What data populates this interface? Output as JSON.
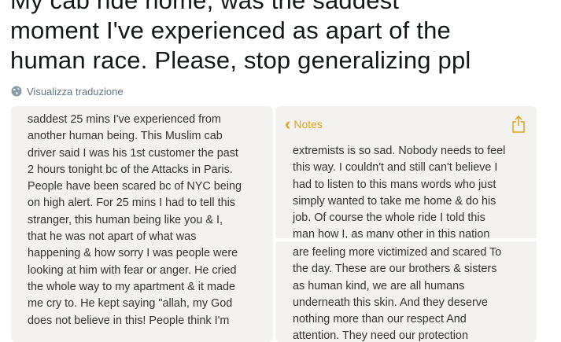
{
  "tweet": {
    "lines": [
      "My cab ride home, was the saddest",
      "moment I've experienced as apart of the",
      "human race. Please, stop generalizing ppl"
    ],
    "translate_label": "Visualizza traduzione",
    "translate_icon": "globe-icon"
  },
  "left_note": {
    "lines": [
      "saddest 25 mins I've experienced from",
      "another human being. This Muslim cab",
      "driver said I was his 1st customer the past",
      "2 hours tonight bc of the Attacks in Paris.",
      "People have been scared bc of NYC being",
      "on high alert. For 25 mins I had to tell this",
      "stranger, this human being like you & I,",
      "that he was not apart of what was",
      "happening & how sorry I was people were",
      "looking at him with fear or anger. He cried",
      "the whole way to my apartment & it made",
      "me cry to. He kept saying \"allah, my God",
      "does not believe in this! People think I'm"
    ]
  },
  "right_note": {
    "header_label": "Notes",
    "back_icon": "chevron-left-icon",
    "share_icon": "share-icon",
    "accent_color": "#e0a31b",
    "top_lines": [
      "extremists is so sad. Nobody needs to feel",
      "this way. I couldn't and still can't believe I",
      "had to listen to this mans words who just",
      "simply wanted to take me home & do his",
      "job. Of course the whole ride I told this",
      "man how I, as many other in this nation"
    ],
    "bottom_lines": [
      "are feeling more victimized and scared To",
      "the day. These are our brothers & sisters",
      "as human kind, we are all humans",
      "underneath this skin. And they deserve",
      "nothing more than our respect And",
      "attention. They need our protection"
    ]
  }
}
